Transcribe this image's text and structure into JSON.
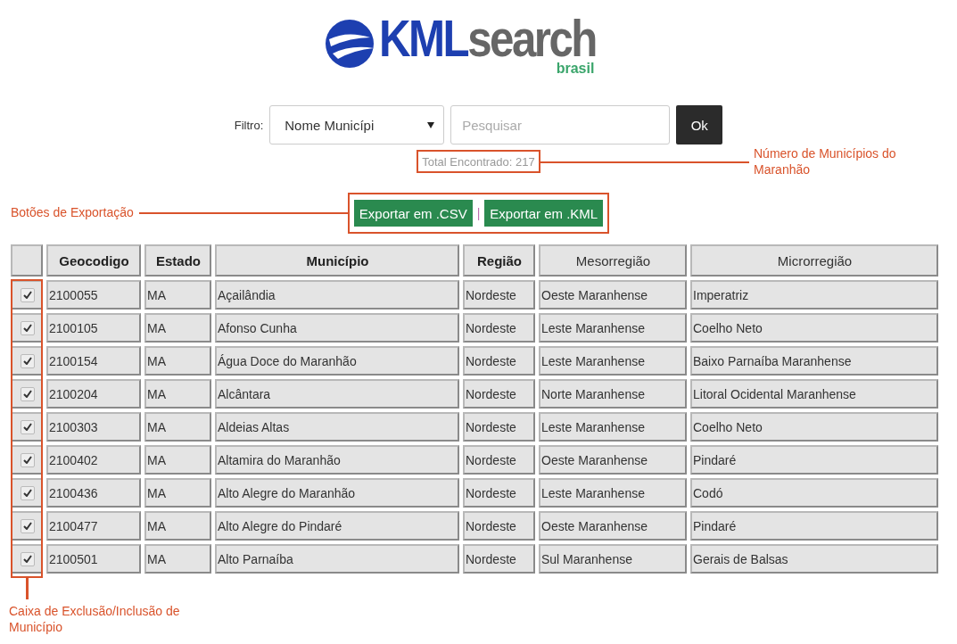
{
  "logo": {
    "primary": "KML",
    "secondary": "search",
    "tagline": "brasil"
  },
  "filter": {
    "label": "Filtro:",
    "select_value": "Nome Municípi",
    "search_placeholder": "Pesquisar",
    "button": "Ok"
  },
  "total": "Total Encontrado: 217",
  "export": {
    "buttons": [
      "Exportar em .CSV",
      "Exportar em .KML"
    ],
    "separator": "|"
  },
  "table": {
    "columns": [
      "Geocodigo",
      "Estado",
      "Município",
      "Região",
      "Mesorregião",
      "Microrregião"
    ],
    "rows": [
      {
        "checked": true,
        "cells": [
          "2100055",
          "MA",
          "Açailândia",
          "Nordeste",
          "Oeste Maranhense",
          "Imperatriz"
        ]
      },
      {
        "checked": true,
        "cells": [
          "2100105",
          "MA",
          "Afonso Cunha",
          "Nordeste",
          "Leste Maranhense",
          "Coelho Neto"
        ]
      },
      {
        "checked": true,
        "cells": [
          "2100154",
          "MA",
          "Água Doce do Maranhão",
          "Nordeste",
          "Leste Maranhense",
          "Baixo Parnaíba Maranhense"
        ]
      },
      {
        "checked": true,
        "cells": [
          "2100204",
          "MA",
          "Alcântara",
          "Nordeste",
          "Norte Maranhense",
          "Litoral Ocidental Maranhense"
        ]
      },
      {
        "checked": true,
        "cells": [
          "2100303",
          "MA",
          "Aldeias Altas",
          "Nordeste",
          "Leste Maranhense",
          "Coelho Neto"
        ]
      },
      {
        "checked": true,
        "cells": [
          "2100402",
          "MA",
          "Altamira do Maranhão",
          "Nordeste",
          "Oeste Maranhense",
          "Pindaré"
        ]
      },
      {
        "checked": true,
        "cells": [
          "2100436",
          "MA",
          "Alto Alegre do Maranhão",
          "Nordeste",
          "Leste Maranhense",
          "Codó"
        ]
      },
      {
        "checked": true,
        "cells": [
          "2100477",
          "MA",
          "Alto Alegre do Pindaré",
          "Nordeste",
          "Oeste Maranhense",
          "Pindaré"
        ]
      },
      {
        "checked": true,
        "cells": [
          "2100501",
          "MA",
          "Alto Parnaíba",
          "Nordeste",
          "Sul Maranhense",
          "Gerais de Balsas"
        ]
      }
    ]
  },
  "annotations": [
    {
      "text": "Número de Municípios do Maranhão"
    },
    {
      "text": "Botões de Exportação"
    },
    {
      "text": "Caixa de Exclusão/Inclusão de Município"
    }
  ]
}
